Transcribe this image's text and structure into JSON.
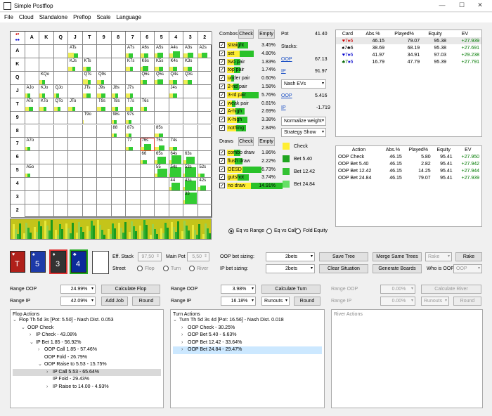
{
  "window": {
    "title": "Simple Postflop",
    "min": "—",
    "max": "☐",
    "close": "✕"
  },
  "menu": [
    "File",
    "Cloud",
    "Standalone",
    "Preflop",
    "Scale",
    "Language"
  ],
  "grid": {
    "ranks": [
      "A",
      "K",
      "Q",
      "J",
      "T",
      "9",
      "8",
      "7",
      "6",
      "5",
      "4",
      "3",
      "2"
    ],
    "cells": [
      {
        "r": 0,
        "c": 4,
        "t": "ATs",
        "g": 0.3,
        "y": 0.4
      },
      {
        "r": 0,
        "c": 8,
        "t": "A7s",
        "g": 0.3,
        "y": 0.2
      },
      {
        "r": 0,
        "c": 9,
        "t": "A6s",
        "g": 0.3,
        "y": 0.3
      },
      {
        "r": 0,
        "c": 10,
        "t": "A5s",
        "g": 0.4,
        "y": 0.2
      },
      {
        "r": 0,
        "c": 11,
        "t": "A4s",
        "g": 0.5,
        "y": 0.3
      },
      {
        "r": 0,
        "c": 12,
        "t": "A3s",
        "g": 0.4,
        "y": 0.3
      },
      {
        "r": 0,
        "c": 13,
        "t": "A2s",
        "g": 0.4,
        "y": 0.3
      },
      {
        "r": 1,
        "c": 4,
        "t": "KJs",
        "g": 0.2,
        "y": 0.3
      },
      {
        "r": 1,
        "c": 5,
        "t": "KTs",
        "g": 0.3,
        "y": 0.3
      },
      {
        "r": 1,
        "c": 8,
        "t": "K7s",
        "g": 0.2,
        "y": 0.3
      },
      {
        "r": 1,
        "c": 9,
        "t": "K6s",
        "g": 0.4,
        "y": 0.2
      },
      {
        "r": 1,
        "c": 10,
        "t": "K5s",
        "g": 0.3,
        "y": 0.3
      },
      {
        "r": 1,
        "c": 11,
        "t": "K4s",
        "g": 0.3,
        "y": 0.3
      },
      {
        "r": 1,
        "c": 12,
        "t": "K3s",
        "g": 0.3,
        "y": 0.3
      },
      {
        "r": 2,
        "c": 2,
        "t": "KQo",
        "g": 0.2,
        "y": 0.2
      },
      {
        "r": 2,
        "c": 5,
        "t": "QTs",
        "g": 0.2,
        "y": 0.4
      },
      {
        "r": 2,
        "c": 6,
        "t": "Q9s",
        "g": 0.2,
        "y": 0.3
      },
      {
        "r": 2,
        "c": 9,
        "t": "Q6s",
        "g": 0.3,
        "y": 0.2
      },
      {
        "r": 2,
        "c": 10,
        "t": "Q5s",
        "g": 0.4,
        "y": 0.2
      },
      {
        "r": 2,
        "c": 11,
        "t": "Q4s",
        "g": 0.3,
        "y": 0.3
      },
      {
        "r": 2,
        "c": 12,
        "t": "Q3s",
        "g": 0.3,
        "y": 0.3
      },
      {
        "r": 3,
        "c": 1,
        "t": "AJo",
        "g": 0.2,
        "y": 0.2
      },
      {
        "r": 3,
        "c": 2,
        "t": "KJo",
        "g": 0.2,
        "y": 0.2
      },
      {
        "r": 3,
        "c": 3,
        "t": "QJo",
        "g": 0.2,
        "y": 0.2
      },
      {
        "r": 3,
        "c": 5,
        "t": "JTs",
        "g": 0.3,
        "y": 0.3
      },
      {
        "r": 3,
        "c": 6,
        "t": "J9s",
        "g": 0.3,
        "y": 0.3
      },
      {
        "r": 3,
        "c": 7,
        "t": "J8s",
        "g": 0.2,
        "y": 0.3
      },
      {
        "r": 3,
        "c": 8,
        "t": "J7s",
        "g": 0.2,
        "y": 0.3
      },
      {
        "r": 3,
        "c": 11,
        "t": "J4s",
        "g": 0.3,
        "y": 0.3
      },
      {
        "r": 4,
        "c": 1,
        "t": "ATo",
        "g": 0.3,
        "y": 0.3
      },
      {
        "r": 4,
        "c": 2,
        "t": "KTo",
        "g": 0.2,
        "y": 0.3
      },
      {
        "r": 4,
        "c": 3,
        "t": "QTo",
        "g": 0.2,
        "y": 0.3
      },
      {
        "r": 4,
        "c": 4,
        "t": "JTo",
        "g": 0.2,
        "y": 0.3
      },
      {
        "r": 4,
        "c": 6,
        "t": "T9s",
        "g": 0.3,
        "y": 0.3
      },
      {
        "r": 4,
        "c": 7,
        "t": "T8s",
        "g": 0.2,
        "y": 0.3
      },
      {
        "r": 4,
        "c": 8,
        "t": "T7s",
        "g": 0.2,
        "y": 0.3
      },
      {
        "r": 4,
        "c": 9,
        "t": "T6s",
        "g": 0.2,
        "y": 0.3
      },
      {
        "r": 5,
        "c": 5,
        "t": "T9o",
        "g": 0.0,
        "y": 0.1
      },
      {
        "r": 5,
        "c": 7,
        "t": "98s",
        "g": 0.2,
        "y": 0.2
      },
      {
        "r": 5,
        "c": 8,
        "t": "97s",
        "g": 0.2,
        "y": 0.2
      },
      {
        "r": 6,
        "c": 7,
        "t": "88",
        "g": 0.2,
        "y": 0.2
      },
      {
        "r": 6,
        "c": 8,
        "t": "87s",
        "g": 0.2,
        "y": 0.2
      },
      {
        "r": 6,
        "c": 10,
        "t": "85s",
        "g": 0.3,
        "y": 0.3
      },
      {
        "r": 7,
        "c": 1,
        "t": "A7o",
        "g": 0.2,
        "y": 0.2
      },
      {
        "r": 7,
        "c": 8,
        "t": "77",
        "g": 0.3,
        "y": 0.2
      },
      {
        "r": 7,
        "c": 9,
        "t": "76s",
        "g": 0.5,
        "y": 0.3
      },
      {
        "r": 7,
        "c": 10,
        "t": "75s",
        "g": 0.4,
        "y": 0.3
      },
      {
        "r": 7,
        "c": 11,
        "t": "74s",
        "g": 0.3,
        "y": 0.3
      },
      {
        "r": 8,
        "c": 9,
        "t": "66",
        "g": 0.3,
        "y": 0.2
      },
      {
        "r": 8,
        "c": 10,
        "t": "65s",
        "g": 0.6,
        "y": 0.2
      },
      {
        "r": 8,
        "c": 11,
        "t": "64s",
        "g": 0.7,
        "y": 0.2
      },
      {
        "r": 8,
        "c": 12,
        "t": "63s",
        "g": 0.6,
        "y": 0.2
      },
      {
        "r": 9,
        "c": 1,
        "t": "A5o",
        "g": 0.2,
        "y": 0.2
      },
      {
        "r": 9,
        "c": 10,
        "t": "55",
        "g": 0.7,
        "y": 0.2
      },
      {
        "r": 9,
        "c": 11,
        "t": "54s",
        "g": 0.8,
        "y": 0.1
      },
      {
        "r": 9,
        "c": 12,
        "t": "53s",
        "g": 0.8,
        "y": 0.1
      },
      {
        "r": 9,
        "c": 13,
        "t": "52s",
        "g": 0.3,
        "y": 0.2
      },
      {
        "r": 10,
        "c": 11,
        "t": "44",
        "g": 0.6,
        "y": 0.2
      },
      {
        "r": 10,
        "c": 12,
        "t": "43s",
        "g": 0.8,
        "y": 0.1
      },
      {
        "r": 10,
        "c": 13,
        "t": "42s",
        "g": 0.4,
        "y": 0.2
      },
      {
        "r": 11,
        "c": 12,
        "t": "33",
        "g": 0.9,
        "y": 0.1
      }
    ]
  },
  "combos": {
    "title": "Combos",
    "check": "Check",
    "empty": "Empty",
    "items": [
      {
        "l": "straight",
        "v": "3.45%",
        "p": 0.35
      },
      {
        "l": "set",
        "v": "4.80%",
        "p": 0.45
      },
      {
        "l": "two pair",
        "v": "1.83%",
        "p": 0.2
      },
      {
        "l": "top pair",
        "v": "1.74%",
        "p": 0.2
      },
      {
        "l": "under pair",
        "v": "0.60%",
        "p": 0.08
      },
      {
        "l": "2-nd pair",
        "v": "1.58%",
        "p": 0.18
      },
      {
        "l": "3-rd pair",
        "v": "5.76%",
        "p": 0.55
      },
      {
        "l": "weak pair",
        "v": "0.81%",
        "p": 0.1
      },
      {
        "l": "A-high",
        "v": "2.69%",
        "p": 0.28
      },
      {
        "l": "K-high",
        "v": "3.38%",
        "p": 0.33
      },
      {
        "l": "nothing",
        "v": "2.84%",
        "p": 0.3
      }
    ]
  },
  "draws": {
    "title": "Draws",
    "check": "Check",
    "empty": "Empty",
    "items": [
      {
        "l": "combo draw",
        "v": "1.86%",
        "p": 0.2
      },
      {
        "l": "flush draw",
        "v": "2.22%",
        "p": 0.24
      },
      {
        "l": "OESD",
        "v": "6.73%",
        "p": 0.6
      },
      {
        "l": "gutshot",
        "v": "3.74%",
        "p": 0.36
      },
      {
        "l": "no draw",
        "v": "14.91%",
        "p": 1.0
      }
    ]
  },
  "pot": {
    "pot_label": "Pot",
    "pot": "41.40",
    "stacks_label": "Stacks:",
    "oop": "OOP",
    "oop_stack": "67.13",
    "ip": "IP",
    "ip_stack": "91.97",
    "ev_select": "Nash EVs",
    "oop2": "OOP",
    "oop_ev": "5.416",
    "ip2": "IP",
    "ip_ev": "-1.719",
    "weight_select": "Normalize weight",
    "strategy_select": "Strategy Show"
  },
  "legend": [
    {
      "l": "Check",
      "c": "#ffee33"
    },
    {
      "l": "Bet 5.40",
      "c": "#1fa51f"
    },
    {
      "l": "Bet 12.42",
      "c": "#33c233"
    },
    {
      "l": "Bet 24.84",
      "c": "#66e066"
    }
  ],
  "radio": {
    "o1": "Eq vs Range",
    "o2": "Eq vs Call",
    "o3": "Fold Equity"
  },
  "cardtable": {
    "headers": [
      "Card",
      "Abs.%",
      "Played%",
      "Equity",
      "EV"
    ],
    "rows": [
      {
        "card": "♥7 ♦6",
        "suits": [
          "#c00",
          "#c00"
        ],
        "abs": "46.15",
        "pl": "79.07",
        "eq": "95.38",
        "ev": "+27.939"
      },
      {
        "card": "♠7 ♣6",
        "suits": [
          "#000",
          "#000"
        ],
        "abs": "38.69",
        "pl": "68.19",
        "eq": "95.38",
        "ev": "+27.691"
      },
      {
        "card": "♥7 ♦6",
        "suits": [
          "#00c",
          "#00c"
        ],
        "abs": "41.97",
        "pl": "34.91",
        "eq": "97.03",
        "ev": "+29.238"
      },
      {
        "card": "♣7 ♦6",
        "suits": [
          "#060",
          "#00c"
        ],
        "abs": "16.79",
        "pl": "47.79",
        "eq": "95.39",
        "ev": "+27.791"
      }
    ]
  },
  "actiontable": {
    "headers": [
      "Action",
      "Abs.%",
      "Played%",
      "Equity",
      "EV"
    ],
    "rows": [
      {
        "a": "OOP Check",
        "abs": "46.15",
        "pl": "5.80",
        "eq": "95.41",
        "ev": "+27.950"
      },
      {
        "a": "OOP Bet 5.40",
        "abs": "46.15",
        "pl": "2.82",
        "eq": "95.41",
        "ev": "+27.942"
      },
      {
        "a": "OOP Bet 12.42",
        "abs": "46.15",
        "pl": "14.25",
        "eq": "95.41",
        "ev": "+27.944"
      },
      {
        "a": "OOP Bet 24.84",
        "abs": "46.15",
        "pl": "79.07",
        "eq": "95.41",
        "ev": "+27.939"
      }
    ]
  },
  "board": [
    {
      "rank": "T",
      "suit": "♥",
      "color": "#b0201a"
    },
    {
      "rank": "5",
      "suit": "♠",
      "color": "#1d3aa8"
    },
    {
      "rank": "3",
      "suit": "♦",
      "color": "#333"
    },
    {
      "rank": "4",
      "suit": "♣",
      "color": "#0b2a9a"
    }
  ],
  "street": {
    "eff_label": "Eff. Stack",
    "eff": "97,50",
    "mainpot_label": "Main Pot",
    "mainpot": "5,50",
    "street_label": "Street",
    "flop": "Flop",
    "turn": "Turn",
    "river": "River"
  },
  "sizing": {
    "oop_label": "OOP bet sizing:",
    "oop_val": "2bets",
    "ip_label": "IP bet sizing:",
    "ip_val": "2bets",
    "save_tree": "Save Tree",
    "merge": "Merge Same Trees",
    "rake_dd": "Rake",
    "rake_btn": "Rake",
    "clear": "Clear Situation",
    "gen": "Generate Boards",
    "who": "Who is OOP:",
    "who_val": "OOP"
  },
  "flopctl": {
    "range_oop": "Range OOP",
    "oop_val": "24.99%",
    "calc": "Calculate Flop",
    "range_ip": "Range IP",
    "ip_val": "42.09%",
    "addjob": "Add Job",
    "round": "Round"
  },
  "turnctl": {
    "range_oop": "Range OOP",
    "oop_val": "3.98%",
    "calc": "Calculate Turn",
    "range_ip": "Range IP",
    "ip_val": "16.18%",
    "runouts": "Runouts",
    "round": "Round"
  },
  "riverctl": {
    "range_oop": "Range OOP",
    "oop_val": "0.00%",
    "calc": "Calculate River",
    "range_ip": "Range IP",
    "ip_val": "0.00%",
    "runouts": "Runouts",
    "round": "Round"
  },
  "flop_actions": {
    "title": "Flop Actions",
    "lines": [
      {
        "d": 0,
        "t": "Flop Th 5d 3s [Pot: 5.50] - Nash Dist. 0.053",
        "o": "v"
      },
      {
        "d": 1,
        "t": "OOP Check",
        "o": "v"
      },
      {
        "d": 2,
        "t": "IP Check - 43.08%",
        "o": ">"
      },
      {
        "d": 2,
        "t": "IP Bet 1.85 - 56.92%",
        "o": "v"
      },
      {
        "d": 3,
        "t": "OOP Call 1.85 - 57.46%",
        "o": ">"
      },
      {
        "d": 3,
        "t": "OOP Fold - 26.79%",
        "o": ""
      },
      {
        "d": 3,
        "t": "OOP Raise to 5.53 - 15.75%",
        "o": "v"
      },
      {
        "d": 4,
        "t": "IP Call 5.53 - 65.64%",
        "o": ">",
        "sel": true
      },
      {
        "d": 4,
        "t": "IP Fold - 29.43%",
        "o": ""
      },
      {
        "d": 4,
        "t": "IP Raise to 14.00 - 4.93%",
        "o": ">"
      }
    ]
  },
  "turn_actions": {
    "title": "Turn Actions",
    "lines": [
      {
        "d": 0,
        "t": "Turn Th 5d 3s 4d [Pot: 16.56] - Nash Dist. 0.018",
        "o": "v"
      },
      {
        "d": 1,
        "t": "OOP Check - 30.25%",
        "o": ">"
      },
      {
        "d": 1,
        "t": "OOP Bet 5.40 - 6.63%",
        "o": ">"
      },
      {
        "d": 1,
        "t": "OOP Bet 12.42 - 33.64%",
        "o": ">"
      },
      {
        "d": 1,
        "t": "OOP Bet 24.84 - 29.47%",
        "o": ">",
        "sel": true
      }
    ]
  },
  "river_actions": {
    "title": "River Actions"
  }
}
